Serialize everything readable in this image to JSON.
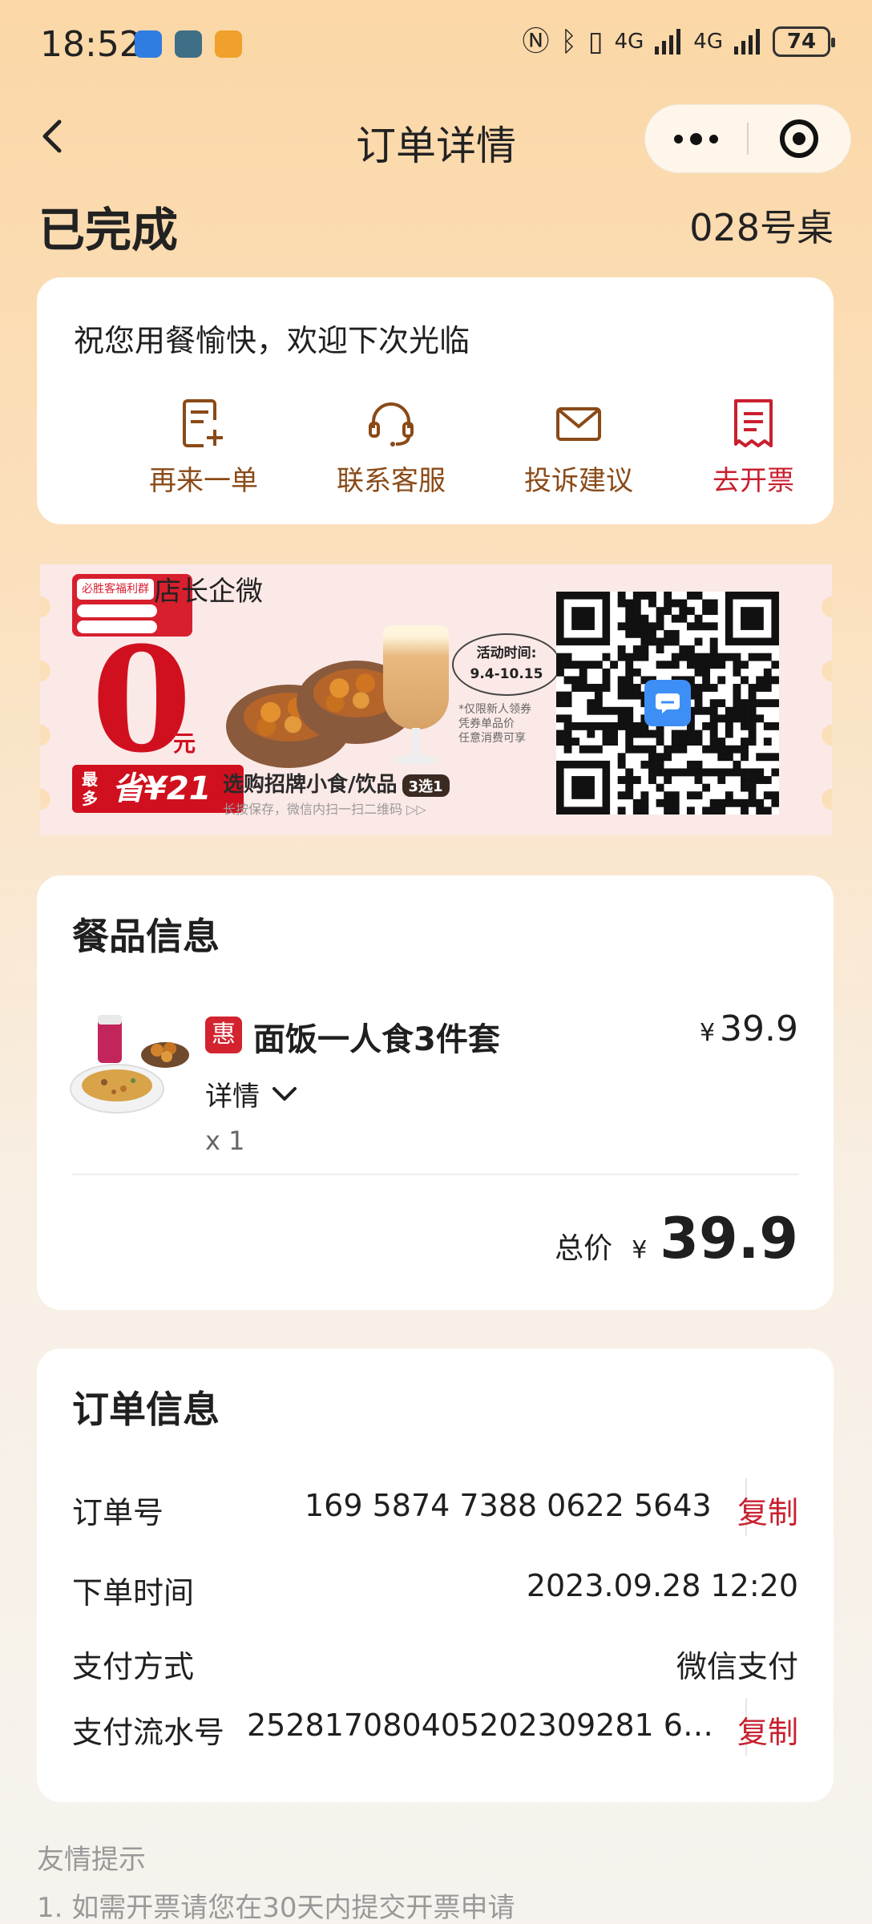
{
  "status_bar": {
    "time": "18:52",
    "network_1": "4G",
    "network_2": "4G",
    "battery": "74",
    "icons": [
      "nfc-icon",
      "bluetooth-icon",
      "vibrate-icon",
      "signal-icon",
      "signal-icon",
      "battery-icon"
    ]
  },
  "nav": {
    "title": "订单详情",
    "back_icon": "back-arrow-icon",
    "more_icon": "more-dots-icon",
    "close_icon": "target-close-icon"
  },
  "order_header": {
    "status": "已完成",
    "table": "028号桌"
  },
  "greeting": {
    "text": "祝您用餐愉快，欢迎下次光临",
    "actions": [
      {
        "label": "再来一单",
        "icon": "reorder-icon",
        "color": "#8a4a17"
      },
      {
        "label": "联系客服",
        "icon": "headset-icon",
        "color": "#8a4a17"
      },
      {
        "label": "投诉建议",
        "icon": "mail-icon",
        "color": "#8a4a17"
      },
      {
        "label": "去开票",
        "icon": "invoice-icon",
        "color": "#c8202f"
      }
    ]
  },
  "banner": {
    "logo_text": "必胜客福利群",
    "heading": "店长企微",
    "big_number": "0",
    "unit": "元",
    "save_prefix": "最多",
    "save_text": "省¥21",
    "choose_text": "选购招牌小食/饮品",
    "choose_tag": "3选1",
    "scan_text": "长按保存，微信内扫一扫二维码 ▷▷",
    "time_label": "活动时间:",
    "time_range": "9.4-10.15",
    "note_lines": [
      "*仅限新人领券",
      "凭券单品价",
      "任意消费可享"
    ]
  },
  "food": {
    "section_title": "餐品信息",
    "item": {
      "badge": "惠",
      "name": "面饭一人食3件套",
      "currency": "¥",
      "price": "39.9",
      "detail_label": "详情",
      "quantity": "x 1"
    },
    "total_label": "总价",
    "total_currency": "¥",
    "total_value": "39.9"
  },
  "order_info": {
    "section_title": "订单信息",
    "rows": [
      {
        "label": "订单号",
        "value": "169 5874 7388 0622 5643",
        "action": "复制"
      },
      {
        "label": "下单时间",
        "value": "2023.09.28 12:20"
      },
      {
        "label": "支付方式",
        "value": "微信支付"
      },
      {
        "label": "支付流水号",
        "value": "252817080405202309281 6…",
        "action": "复制"
      }
    ]
  },
  "tips": {
    "title": "友情提示",
    "line1": "1. 如需开票请您在30天内提交开票申请"
  },
  "colors": {
    "accent_red": "#c8202f",
    "action_brown": "#8a4a17",
    "bg_top": "#fbd7a6"
  }
}
